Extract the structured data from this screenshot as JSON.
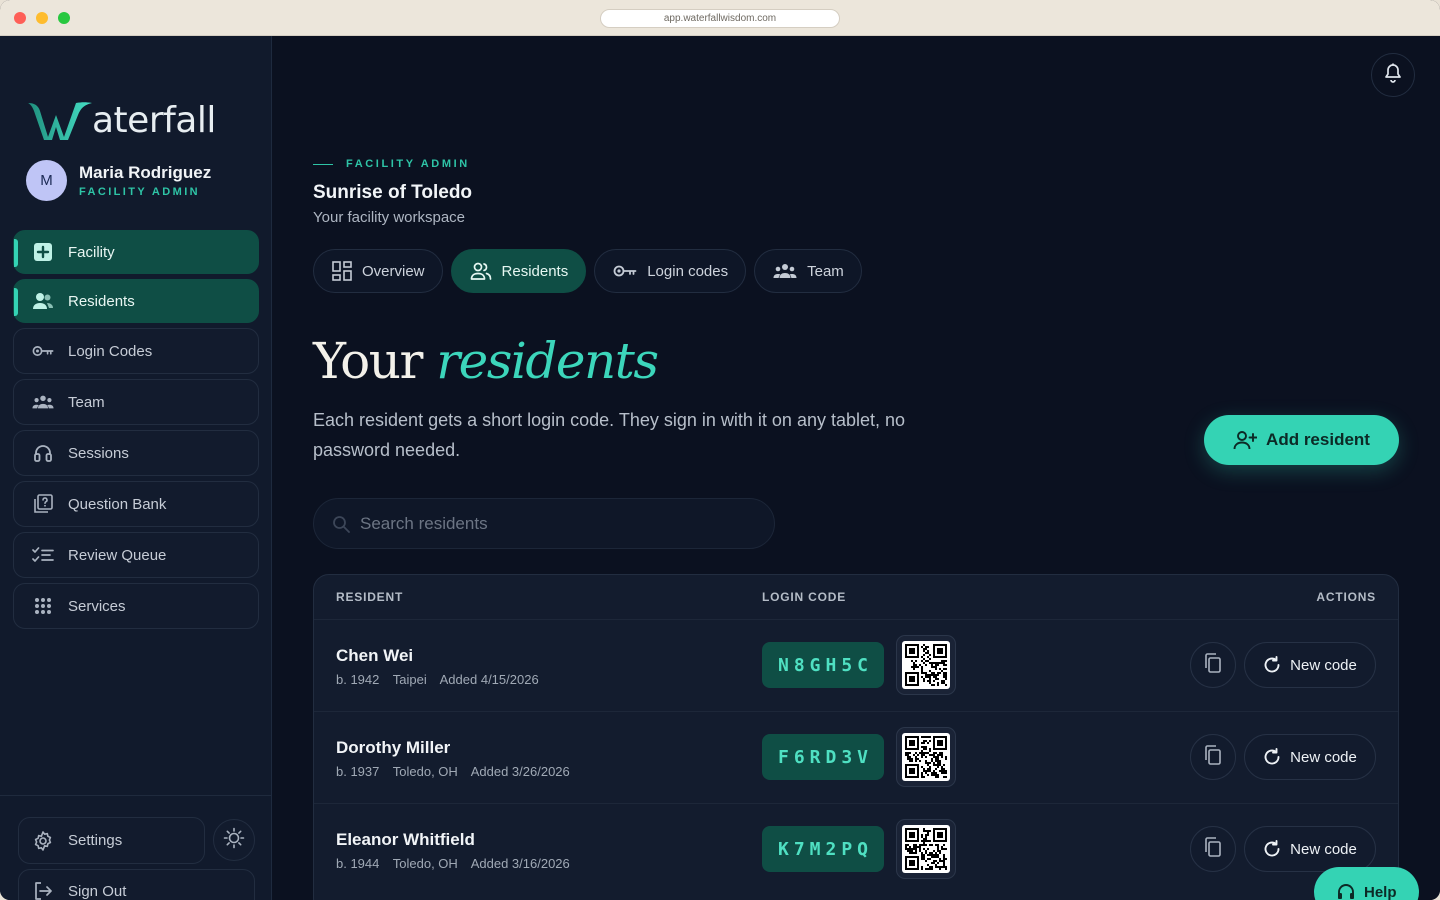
{
  "browser": {
    "url": "app.waterfallwisdom.com"
  },
  "brand": {
    "logo_text": "aterfall",
    "accent": "#34d3b4",
    "active_bg": "#0f4e45"
  },
  "user": {
    "initial": "M",
    "name": "Maria Rodriguez",
    "role": "FACILITY ADMIN"
  },
  "sidebar": {
    "items": [
      {
        "label": "Facility",
        "icon": "plus-square-icon",
        "active": true
      },
      {
        "label": "Residents",
        "icon": "users-icon",
        "active": true
      },
      {
        "label": "Login Codes",
        "icon": "key-icon",
        "active": false
      },
      {
        "label": "Team",
        "icon": "team-icon",
        "active": false
      },
      {
        "label": "Sessions",
        "icon": "headphones-icon",
        "active": false
      },
      {
        "label": "Question Bank",
        "icon": "question-icon",
        "active": false
      },
      {
        "label": "Review Queue",
        "icon": "checklist-icon",
        "active": false
      },
      {
        "label": "Services",
        "icon": "grid-dots-icon",
        "active": false
      }
    ],
    "settings_label": "Settings",
    "signout_label": "Sign Out"
  },
  "header": {
    "eyebrow": "FACILITY ADMIN",
    "facility_name": "Sunrise of Toledo",
    "facility_sub": "Your facility workspace"
  },
  "tabs": [
    {
      "label": "Overview",
      "icon": "dashboard-icon",
      "active": false
    },
    {
      "label": "Residents",
      "icon": "users-icon",
      "active": true
    },
    {
      "label": "Login codes",
      "icon": "key-icon",
      "active": false
    },
    {
      "label": "Team",
      "icon": "team-icon",
      "active": false
    }
  ],
  "page": {
    "heading_plain": "Your",
    "heading_em": "residents",
    "lede": "Each resident gets a short login code. They sign in with it on any tablet, no password needed.",
    "add_button": "Add resident",
    "search_placeholder": "Search residents"
  },
  "table": {
    "headers": {
      "resident": "RESIDENT",
      "code": "LOGIN CODE",
      "actions": "ACTIONS"
    },
    "new_code_label": "New code",
    "rows": [
      {
        "name": "Chen Wei",
        "born": "b. 1942",
        "place": "Taipei",
        "added": "Added 4/15/2026",
        "code": "N8GH5C"
      },
      {
        "name": "Dorothy Miller",
        "born": "b. 1937",
        "place": "Toledo, OH",
        "added": "Added 3/26/2026",
        "code": "F6RD3V"
      },
      {
        "name": "Eleanor Whitfield",
        "born": "b. 1944",
        "place": "Toledo, OH",
        "added": "Added 3/16/2026",
        "code": "K7M2PQ"
      }
    ]
  },
  "help": {
    "label": "Help"
  }
}
